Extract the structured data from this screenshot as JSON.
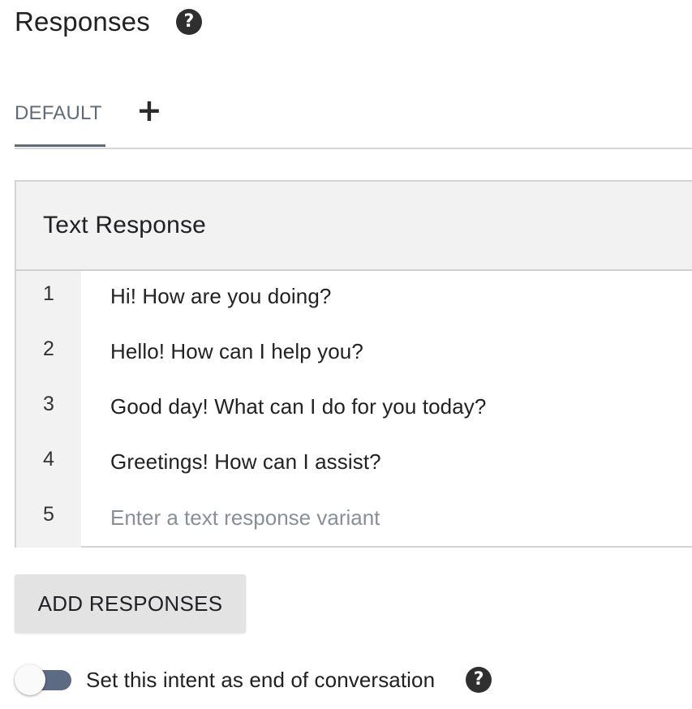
{
  "header": {
    "title": "Responses",
    "help_icon": "?"
  },
  "tabs": {
    "default_label": "DEFAULT",
    "add_symbol": "+"
  },
  "text_response": {
    "title": "Text Response",
    "rows": [
      {
        "number": "1",
        "text": "Hi! How are you doing?"
      },
      {
        "number": "2",
        "text": "Hello! How can I help you?"
      },
      {
        "number": "3",
        "text": "Good day! What can I do for you today?"
      },
      {
        "number": "4",
        "text": "Greetings! How can I assist?"
      }
    ],
    "new_row": {
      "number": "5",
      "value": "",
      "placeholder": "Enter a text response variant"
    }
  },
  "add_responses_label": "ADD RESPONSES",
  "end_conversation": {
    "label": "Set this intent as end of conversation",
    "enabled": false,
    "help_icon": "?"
  },
  "colors": {
    "accent": "#5f6b7a",
    "toggle_track": "#5c6a84",
    "panel_bg": "#f2f2f2",
    "button_bg": "#e3e3e3"
  },
  "icons": {
    "help": "help-circle-icon",
    "add_tab": "plus-icon"
  }
}
